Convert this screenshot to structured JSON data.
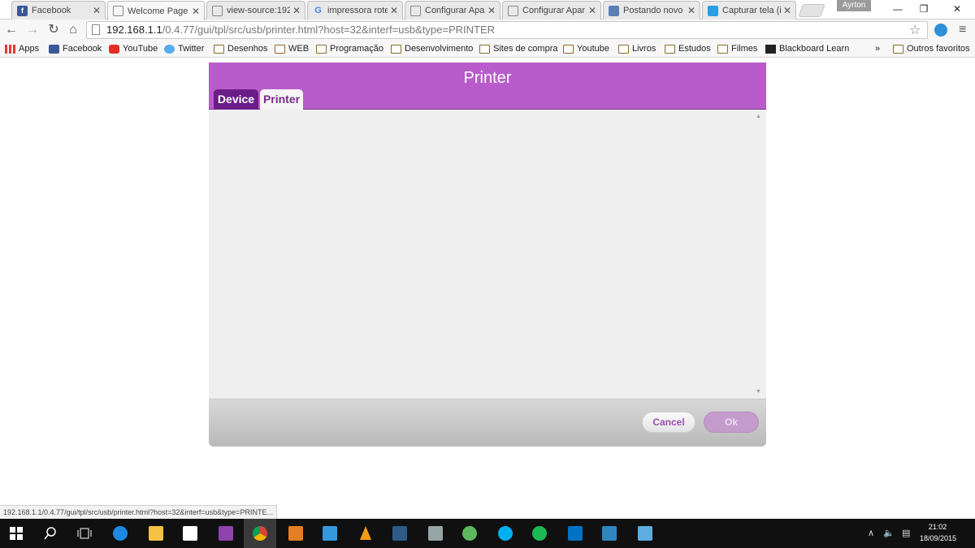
{
  "browser": {
    "tabs": [
      {
        "title": "Facebook",
        "icon": "facebook-icon",
        "color": "#3b5998"
      },
      {
        "title": "Welcome Page",
        "icon": "page-icon",
        "color": "#ffffff",
        "active": true
      },
      {
        "title": "view-source:192",
        "icon": "page-icon",
        "color": "#ffffff"
      },
      {
        "title": "impressora rote",
        "icon": "google-icon",
        "color": "#4285f4"
      },
      {
        "title": "Configurar Apar",
        "icon": "page-icon",
        "color": "#ffffff"
      },
      {
        "title": "Configurar Apar",
        "icon": "page-icon",
        "color": "#ffffff"
      },
      {
        "title": "Postando novo",
        "icon": "blogger-icon",
        "color": "#5b7fb5"
      },
      {
        "title": "Capturar tela (ir",
        "icon": "windows-icon",
        "color": "#2b9fe0"
      }
    ],
    "tab_close_glyph": "✕",
    "profile_name": "Ayrton",
    "window_controls": {
      "minimize": "—",
      "restore": "❐",
      "close": "✕"
    },
    "address": {
      "host": "192.168.1.1",
      "path": "/0.4.77/gui/tpl/src/usb/printer.html?host=32&interf=usb&type=PRINTER"
    },
    "nav_glyphs": {
      "back": "←",
      "forward": "→",
      "reload": "↻",
      "home": "⌂",
      "star": "☆",
      "menu": "≡"
    },
    "bookmarks": [
      {
        "label": "Apps",
        "icon": "apps-grid-icon"
      },
      {
        "label": "Facebook",
        "icon": "facebook-icon"
      },
      {
        "label": "YouTube",
        "icon": "youtube-icon"
      },
      {
        "label": "Twitter",
        "icon": "twitter-icon"
      },
      {
        "label": "Desenhos",
        "icon": "folder-icon"
      },
      {
        "label": "WEB",
        "icon": "folder-icon"
      },
      {
        "label": "Programação",
        "icon": "folder-icon"
      },
      {
        "label": "Desenvolvimento",
        "icon": "folder-icon"
      },
      {
        "label": "Sites de compra",
        "icon": "folder-icon"
      },
      {
        "label": "Youtube",
        "icon": "folder-icon"
      },
      {
        "label": "Livros",
        "icon": "folder-icon"
      },
      {
        "label": "Estudos",
        "icon": "folder-icon"
      },
      {
        "label": "Filmes",
        "icon": "folder-icon"
      },
      {
        "label": "Blackboard Learn",
        "icon": "blackboard-icon"
      }
    ],
    "bookmarks_overflow": "»",
    "other_bookmarks": "Outros favoritos",
    "status_url": "192.168.1.1/0.4.77/gui/tpl/src/usb/printer.html?host=32&interf=usb&type=PRINTE..."
  },
  "dialog": {
    "title": "Printer",
    "tabs": {
      "device": "Device",
      "printer": "Printer"
    },
    "cancel_label": "Cancel",
    "ok_label": "Ok",
    "scroll_up": "▲",
    "scroll_down": "▼",
    "accent_color": "#b85ccb"
  },
  "taskbar": {
    "apps": [
      {
        "icon": "start-windows-icon",
        "color": "#ffffff"
      },
      {
        "icon": "search-icon",
        "color": "#ffffff"
      },
      {
        "icon": "task-view-icon",
        "color": "#ffffff"
      },
      {
        "icon": "edge-icon",
        "color": "#1e88e5"
      },
      {
        "icon": "file-explorer-icon",
        "color": "#f6c244"
      },
      {
        "icon": "store-icon",
        "color": "#ffffff"
      },
      {
        "icon": "visual-studio-icon",
        "color": "#8e44ad"
      },
      {
        "icon": "chrome-icon",
        "color": "#db4437",
        "active": true
      },
      {
        "icon": "media-player-icon",
        "color": "#e67e22"
      },
      {
        "icon": "calendar-app-icon",
        "color": "#3498db"
      },
      {
        "icon": "vlc-icon",
        "color": "#f39c12"
      },
      {
        "icon": "mysql-workbench-icon",
        "color": "#2c5b8a"
      },
      {
        "icon": "tools-icon",
        "color": "#95a5a6"
      },
      {
        "icon": "utorrent-icon",
        "color": "#5cb85c"
      },
      {
        "icon": "skype-icon",
        "color": "#00aff0"
      },
      {
        "icon": "spotify-icon",
        "color": "#1db954"
      },
      {
        "icon": "outlook-icon",
        "color": "#0072c6"
      },
      {
        "icon": "paint-icon",
        "color": "#2e86c1"
      },
      {
        "icon": "remote-desktop-icon",
        "color": "#5dade2"
      }
    ],
    "tray": {
      "chevron": "∧",
      "volume": "🔈",
      "notifications": "▤"
    },
    "clock": {
      "time": "21:02",
      "date": "18/09/2015"
    }
  }
}
